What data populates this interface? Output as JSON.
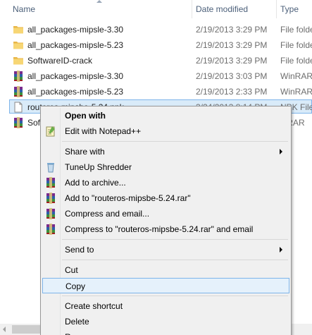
{
  "columns": {
    "name": "Name",
    "date": "Date modified",
    "type": "Type"
  },
  "files": [
    {
      "name": "all_packages-mipsle-3.30",
      "date": "2/19/2013 3:29 PM",
      "type": "File folder",
      "icon": "folder-icon"
    },
    {
      "name": "all_packages-mipsle-5.23",
      "date": "2/19/2013 3:29 PM",
      "type": "File folder",
      "icon": "folder-icon"
    },
    {
      "name": "SoftwareID-crack",
      "date": "2/19/2013 3:29 PM",
      "type": "File folder",
      "icon": "folder-icon"
    },
    {
      "name": "all_packages-mipsle-3.30",
      "date": "2/19/2013 3:03 PM",
      "type": "WinRAR",
      "icon": "winrar-icon"
    },
    {
      "name": "all_packages-mipsle-5.23",
      "date": "2/19/2013 2:33 PM",
      "type": "WinRAR",
      "icon": "winrar-icon"
    },
    {
      "name": "routeros-mipsbe-5.24.npk",
      "date": "3/24/2013 8:14 PM",
      "type": "NPK File",
      "icon": "file-icon",
      "selected": true
    },
    {
      "name": "Sof",
      "date": "",
      "type": "inRAR",
      "icon": "winrar-icon"
    }
  ],
  "menu": {
    "items": [
      {
        "label": "Open with",
        "bold": true
      },
      {
        "label": "Edit with Notepad++",
        "icon": "notepadpp-icon"
      },
      {
        "sep": true
      },
      {
        "label": "Share with",
        "submenu": true
      },
      {
        "label": "TuneUp Shredder",
        "icon": "shredder-icon"
      },
      {
        "label": "Add to archive...",
        "icon": "winrar-icon"
      },
      {
        "label": "Add to \"routeros-mipsbe-5.24.rar\"",
        "icon": "winrar-icon"
      },
      {
        "label": "Compress and email...",
        "icon": "winrar-icon"
      },
      {
        "label": "Compress to \"routeros-mipsbe-5.24.rar\" and email",
        "icon": "winrar-icon"
      },
      {
        "sep": true
      },
      {
        "label": "Send to",
        "submenu": true
      },
      {
        "sep": true
      },
      {
        "label": "Cut"
      },
      {
        "label": "Copy",
        "highlighted": true
      },
      {
        "sep": true
      },
      {
        "label": "Create shortcut"
      },
      {
        "label": "Delete"
      },
      {
        "label": "Re"
      }
    ]
  }
}
